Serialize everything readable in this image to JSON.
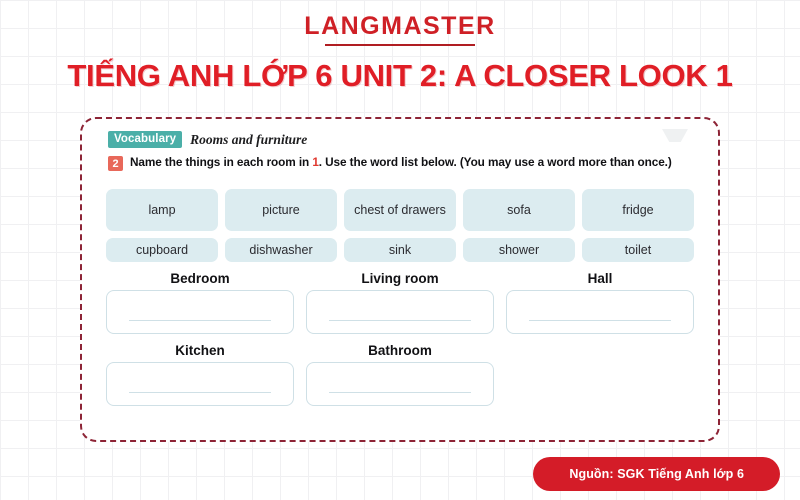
{
  "brand": {
    "name": "LANGMASTER"
  },
  "page_title": "TIẾNG ANH LỚP 6 UNIT 2: A CLOSER LOOK 1",
  "worksheet": {
    "vocabulary_badge": "Vocabulary",
    "topic": "Rooms and furniture",
    "exercise_number": "2",
    "instruction_before": "Name the things in each room in ",
    "instruction_highlight": "1",
    "instruction_after": ". Use the word list below. (You may use a word more than once.)",
    "word_bank": [
      {
        "text": "lamp",
        "two_line": false
      },
      {
        "text": "picture",
        "two_line": false
      },
      {
        "text": "chest of drawers",
        "two_line": true
      },
      {
        "text": "sofa",
        "two_line": false
      },
      {
        "text": "fridge",
        "two_line": false
      },
      {
        "text": "cupboard",
        "two_line": false
      },
      {
        "text": "dishwasher",
        "two_line": false
      },
      {
        "text": "sink",
        "two_line": false
      },
      {
        "text": "shower",
        "two_line": false
      },
      {
        "text": "toilet",
        "two_line": false
      }
    ],
    "rooms_row1": [
      {
        "label": "Bedroom",
        "answer": ""
      },
      {
        "label": "Living room",
        "answer": ""
      },
      {
        "label": "Hall",
        "answer": ""
      }
    ],
    "rooms_row2": [
      {
        "label": "Kitchen",
        "answer": ""
      },
      {
        "label": "Bathroom",
        "answer": ""
      }
    ]
  },
  "source_label": "Nguồn: SGK Tiếng Anh lớp 6",
  "colors": {
    "brand_red": "#cf2026",
    "title_red": "#e01e26",
    "dashed_border": "#8d2436",
    "vocab_teal": "#4bafa8",
    "number_badge": "#e8685a",
    "word_chip": "#dcecf0",
    "answer_border": "#cfe0e6",
    "source_pill": "#d41c28"
  }
}
